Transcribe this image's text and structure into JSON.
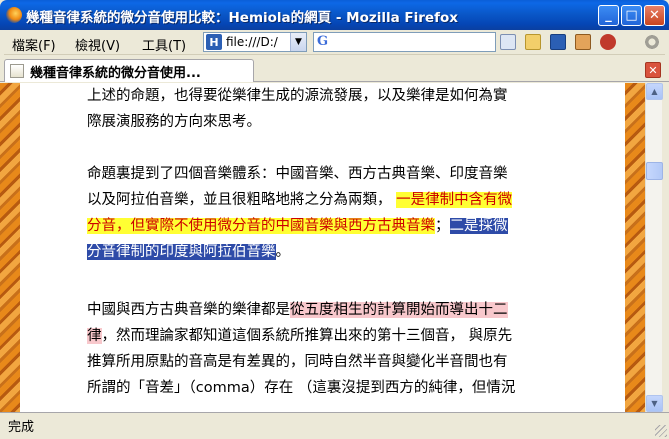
{
  "window": {
    "title": "幾種音律系統的微分音使用比較：Hemiola的網頁 - Mozilla Firefox",
    "minimize": "_",
    "maximize": "□",
    "close": "✕"
  },
  "menu": {
    "file": "檔案(F)",
    "view": "檢視(V)",
    "tools": "工具(T)"
  },
  "toolbar": {
    "url_icon": "H",
    "url_value": "file:///D:/",
    "url_dropdown": "▼",
    "search_icon": "G",
    "icons": [
      "bookmarks-icon",
      "folder-icon",
      "hemiola-icon",
      "image-icon",
      "dragon-icon",
      "throbber-icon"
    ]
  },
  "tab": {
    "label": "幾種音律系統的微分音使用...",
    "close": "✕"
  },
  "content": {
    "p1": [
      "上述的命題，也得要從樂律生成的源流發展，以及樂律是如何為實",
      "際展演服務的方向來思考。"
    ],
    "p2": {
      "line1": "命題裏提到了四個音樂體系：中國音樂、西方古典音樂、印度音樂",
      "line2_plain": "以及阿拉伯音樂，並且很粗略地將之分為兩類，",
      "line2_hl": "一是律制中含有微",
      "line3_hl": "分音，但實際不使用微分音的中國音樂與西方古典音樂",
      "line3_sep": "；",
      "line3_blue": "二是採微",
      "line4_blue": "分音律制的印度與阿拉伯音樂",
      "line4_end": "。"
    },
    "p3": {
      "line1_plain": "中國與西方古典音樂的樂律都是",
      "line1_pink": "從五度相生的計算開始而導出十二",
      "line2_pink": "律",
      "line2_plain": "，然而理論家都知道這個系統所推算出來的第十三個音， 與原先",
      "line3": "推算所用原點的音高是有差異的，同時自然半音與變化半音間也有",
      "line4": "所謂的「音差」（comma）存在 （這裏沒提到西方的純律，但情況"
    }
  },
  "status": {
    "text": "完成"
  },
  "colors": {
    "highlight_yellow": "#FFFF33",
    "highlight_red_text": "#CC0000",
    "highlight_blue": "#2E4BA8",
    "highlight_pink": "#F8C8CC",
    "title_bar": "#0A58C9",
    "page_border": "#E8891A"
  }
}
